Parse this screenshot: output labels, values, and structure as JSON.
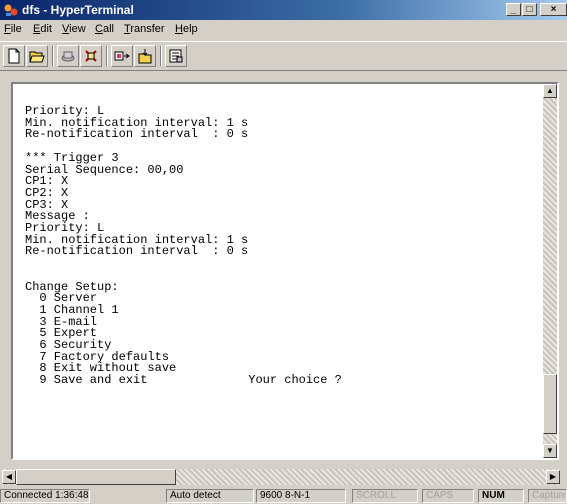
{
  "window": {
    "title": "dfs - HyperTerminal"
  },
  "menu": [
    {
      "label": "File",
      "accel": "F",
      "rest": "ile"
    },
    {
      "label": "Edit",
      "accel": "E",
      "rest": "dit"
    },
    {
      "label": "View",
      "accel": "V",
      "rest": "iew"
    },
    {
      "label": "Call",
      "accel": "C",
      "rest": "all"
    },
    {
      "label": "Transfer",
      "accel": "T",
      "rest": "ransfer"
    },
    {
      "label": "Help",
      "accel": "H",
      "rest": "elp"
    }
  ],
  "toolbar": {
    "buttons": [
      "new-icon",
      "open-icon",
      "connect-icon",
      "disconnect-icon",
      "send-icon",
      "receive-icon",
      "properties-icon"
    ]
  },
  "terminal": {
    "lines": [
      "Priority: L",
      "Min. notification interval: 1 s",
      "Re-notification interval  : 0 s",
      "",
      "*** Trigger 3",
      "Serial Sequence: 00,00",
      "CP1: X",
      "CP2: X",
      "CP3: X",
      "Message :",
      "Priority: L",
      "Min. notification interval: 1 s",
      "Re-notification interval  : 0 s",
      "",
      "",
      "Change Setup:",
      "  0 Server",
      "  1 Channel 1",
      "  3 E-mail",
      "  5 Expert",
      "  6 Security",
      "  7 Factory defaults",
      "  8 Exit without save",
      "  9 Save and exit              Your choice ?"
    ]
  },
  "status": {
    "connected": "Connected 1:36:48",
    "emulation": "Auto detect",
    "settings": "9600 8-N-1",
    "scroll": "SCROLL",
    "caps": "CAPS",
    "num": "NUM",
    "capture": "Capture"
  }
}
